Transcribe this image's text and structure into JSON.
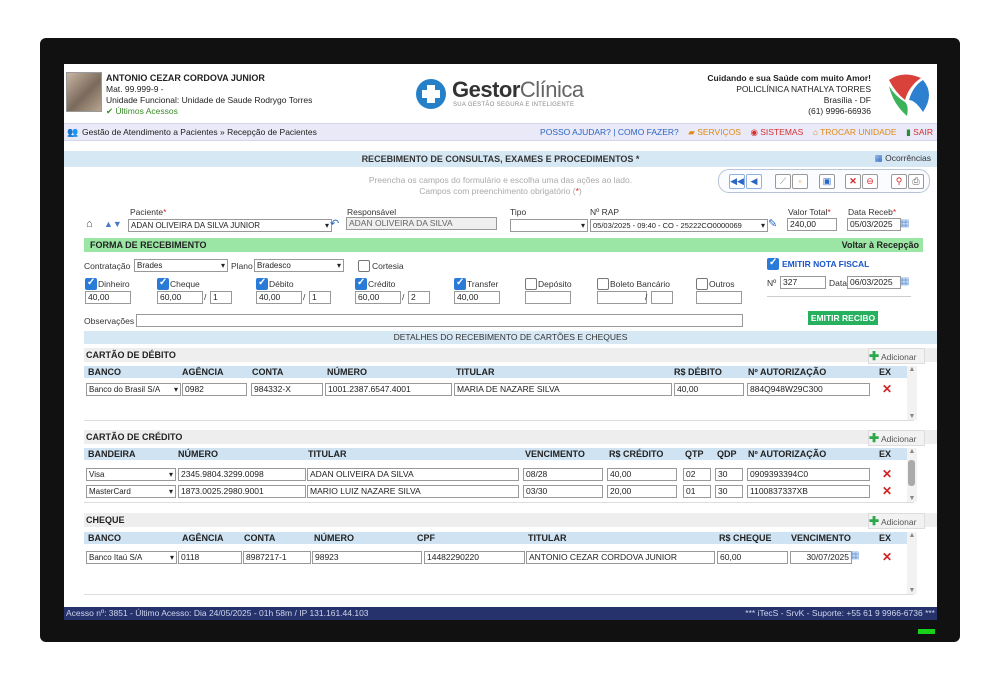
{
  "user": {
    "name": "ANTONIO CEZAR CORDOVA JUNIOR",
    "mat": "Mat. 99.999-9  -",
    "unit": "Unidade Funcional: Unidade de Saude Rodrygo Torres",
    "last_access": "Últimos Acessos"
  },
  "logo": {
    "bold": "Gestor",
    "light": "Clínica",
    "tagline": "SUA GESTÃO SEGURA E INTELIGENTE"
  },
  "clinic": {
    "slogan": "Cuidando e sua Saúde com muito Amor!",
    "name": "POLICLÍNICA NATHALYA TORRES",
    "city": "Brasília - DF",
    "phone": "(61) 9996-66936"
  },
  "nav": {
    "breadcrumb": "Gestão de Atendimento a Pacientes » Recepção de Pacientes",
    "help": "POSSO AJUDAR?",
    "howto": "COMO FAZER?",
    "services": "SERVIÇOS",
    "systems": "SISTEMAS",
    "switch_unit": "TROCAR UNIDADE",
    "exit": "SAIR"
  },
  "page": {
    "title": "RECEBIMENTO DE CONSULTAS, EXAMES E PROCEDIMENTOS *",
    "occurrences": "Ocorrências",
    "hint1": "Preencha os campos do formulário e escolha uma das ações ao lado.",
    "hint2": "Campos com preenchimento obrigatório (",
    "hint2_req": "*",
    "hint2_end": ")"
  },
  "form": {
    "patient_label": "Paciente",
    "patient_value": "ADAN OLIVEIRA DA SILVA JUNIOR",
    "responsible_label": "Responsável",
    "responsible_value": "ADAN OLIVEIRA DA SILVA",
    "type_label": "Tipo",
    "type_value": "",
    "rap_label": "Nº RAP",
    "rap_value": "05/03/2025 - 09:40 - CO - 25222CO0000069",
    "total_label": "Valor Total",
    "total_value": "240,00",
    "date_label": "Data Receb",
    "date_value": "05/03/2025",
    "req_mark": "*"
  },
  "payment": {
    "section_title": "FORMA DE RECEBIMENTO",
    "back_link": "Voltar à Recepção",
    "contract_label": "Contratação",
    "contract_value": "Brades",
    "plan_label": "Plano",
    "plan_value": "Bradesco",
    "courtesy_label": "Cortesia",
    "methods": [
      {
        "label": "Dinheiro",
        "checked": true,
        "value": "40,00",
        "parcels": ""
      },
      {
        "label": "Cheque",
        "checked": true,
        "value": "60,00",
        "parcels": "1"
      },
      {
        "label": "Débito",
        "checked": true,
        "value": "40,00",
        "parcels": "1"
      },
      {
        "label": "Crédito",
        "checked": true,
        "value": "60,00",
        "parcels": "2"
      },
      {
        "label": "Transfer",
        "checked": true,
        "value": "40,00",
        "parcels": ""
      },
      {
        "label": "Depósito",
        "checked": false,
        "value": "",
        "parcels": ""
      },
      {
        "label": "Boleto Bancário",
        "checked": false,
        "value": "",
        "parcels": ""
      },
      {
        "label": "Outros",
        "checked": false,
        "value": "",
        "parcels": ""
      }
    ],
    "slash": "/",
    "notes_label": "Observações",
    "notes_value": "",
    "invoice_label": "EMITIR NOTA FISCAL",
    "invoice_no_label": "Nº",
    "invoice_no": "327",
    "invoice_date_label": "Data",
    "invoice_date": "06/03/2025",
    "receipt_button": "EMITIR RECIBO"
  },
  "details_title": "DETALHES DO RECEBIMENTO DE CARTÕES E CHEQUES",
  "add_label": "Adicionar",
  "debit": {
    "title": "CARTÃO DE DÉBITO",
    "headers": [
      "BANCO",
      "AGÊNCIA",
      "CONTA",
      "NÚMERO",
      "TITULAR",
      "R$ DÉBITO",
      "Nº AUTORIZAÇÃO",
      "EX"
    ],
    "rows": [
      {
        "bank": "Banco do Brasil S/A",
        "agency": "0982",
        "account": "984332-X",
        "number": "1001.2387.6547.4001",
        "holder": "MARIA DE NAZARE SILVA",
        "value": "40,00",
        "auth": "884Q948W29C300"
      }
    ]
  },
  "credit": {
    "title": "CARTÃO DE CRÉDITO",
    "headers": [
      "BANDEIRA",
      "NÚMERO",
      "TITULAR",
      "VENCIMENTO",
      "R$ CRÉDITO",
      "QTP",
      "QDP",
      "Nº AUTORIZAÇÃO",
      "EX"
    ],
    "rows": [
      {
        "brand": "Visa",
        "number": "2345.9804.3299.0098",
        "holder": "ADAN OLIVEIRA DA SILVA",
        "due": "08/28",
        "value": "40,00",
        "qtp": "02",
        "qdp": "30",
        "auth": "0909393394C0"
      },
      {
        "brand": "MasterCard",
        "number": "1873.0025.2980.9001",
        "holder": "MARIO LUIZ NAZARE SILVA",
        "due": "03/30",
        "value": "20,00",
        "qtp": "01",
        "qdp": "30",
        "auth": "1100837337XB"
      }
    ]
  },
  "cheque": {
    "title": "CHEQUE",
    "headers": [
      "BANCO",
      "AGÊNCIA",
      "CONTA",
      "NÚMERO",
      "CPF",
      "TITULAR",
      "R$ CHEQUE",
      "VENCIMENTO",
      "EX"
    ],
    "rows": [
      {
        "bank": "Banco Itaú S/A",
        "agency": "0118",
        "account": "8987217-1",
        "number": "98923",
        "cpf": "14482290220",
        "holder": "ANTONIO CEZAR CORDOVA JUNIOR",
        "value": "60,00",
        "due": "30/07/2025"
      }
    ]
  },
  "footer": {
    "left": "Acesso nº:  3851 - Último Acesso:  Dia 24/05/2025 - 01h 58m / IP  131.161.44.103",
    "right": "*** iTecS - SrvK - Suporte: +55 61 9 9966-6736 ***"
  },
  "colors": {
    "accent_blue": "#2680c8",
    "green_bar": "#9be6a4",
    "footer_bg": "#25326b",
    "danger": "#d42323"
  }
}
